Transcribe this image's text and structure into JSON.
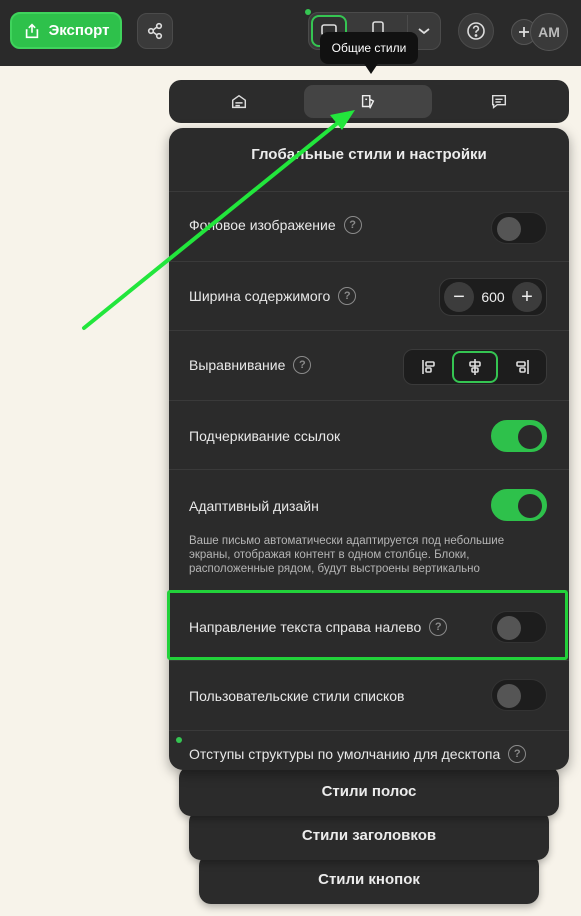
{
  "topbar": {
    "export_label": "Экспорт",
    "avatar_initials": "AM"
  },
  "tooltip": {
    "text": "Общие стили"
  },
  "tabs": [
    {
      "icon": "template-icon",
      "active": false
    },
    {
      "icon": "paint-style-icon",
      "active": true
    },
    {
      "icon": "comment-icon",
      "active": false
    }
  ],
  "panel": {
    "title": "Глобальные стили и настройки",
    "rows": {
      "background_image": {
        "label": "Фоновое изображение",
        "enabled": false
      },
      "content_width": {
        "label": "Ширина содержимого",
        "value": "600",
        "minus": "−",
        "plus": "+"
      },
      "alignment": {
        "label": "Выравнивание",
        "selected": "center"
      },
      "link_underline": {
        "label": "Подчеркивание ссылок",
        "enabled": true
      },
      "adaptive": {
        "label": "Адаптивный дизайн",
        "enabled": true,
        "description_lines": [
          "Ваше письмо автоматически адаптируется под небольшие",
          "экраны, отображая контент в одном столбце. Блоки,",
          "расположенные рядом, будут выстроены вертикально"
        ]
      },
      "rtl": {
        "label": "Направление текста справа налево",
        "enabled": false
      },
      "custom_lists": {
        "label": "Пользовательские стили списков",
        "enabled": false
      },
      "desktop_padding": {
        "label": "Отступы структуры по умолчанию для десктопа"
      }
    }
  },
  "stacked_sections": {
    "stripes": "Стили полос",
    "headings": "Стили заголовков",
    "buttons": "Стили кнопок"
  },
  "help_mark": "?",
  "colors": {
    "accent": "#2ec14b",
    "annotation": "#22d13a",
    "panel_bg": "#2b2b2b"
  }
}
